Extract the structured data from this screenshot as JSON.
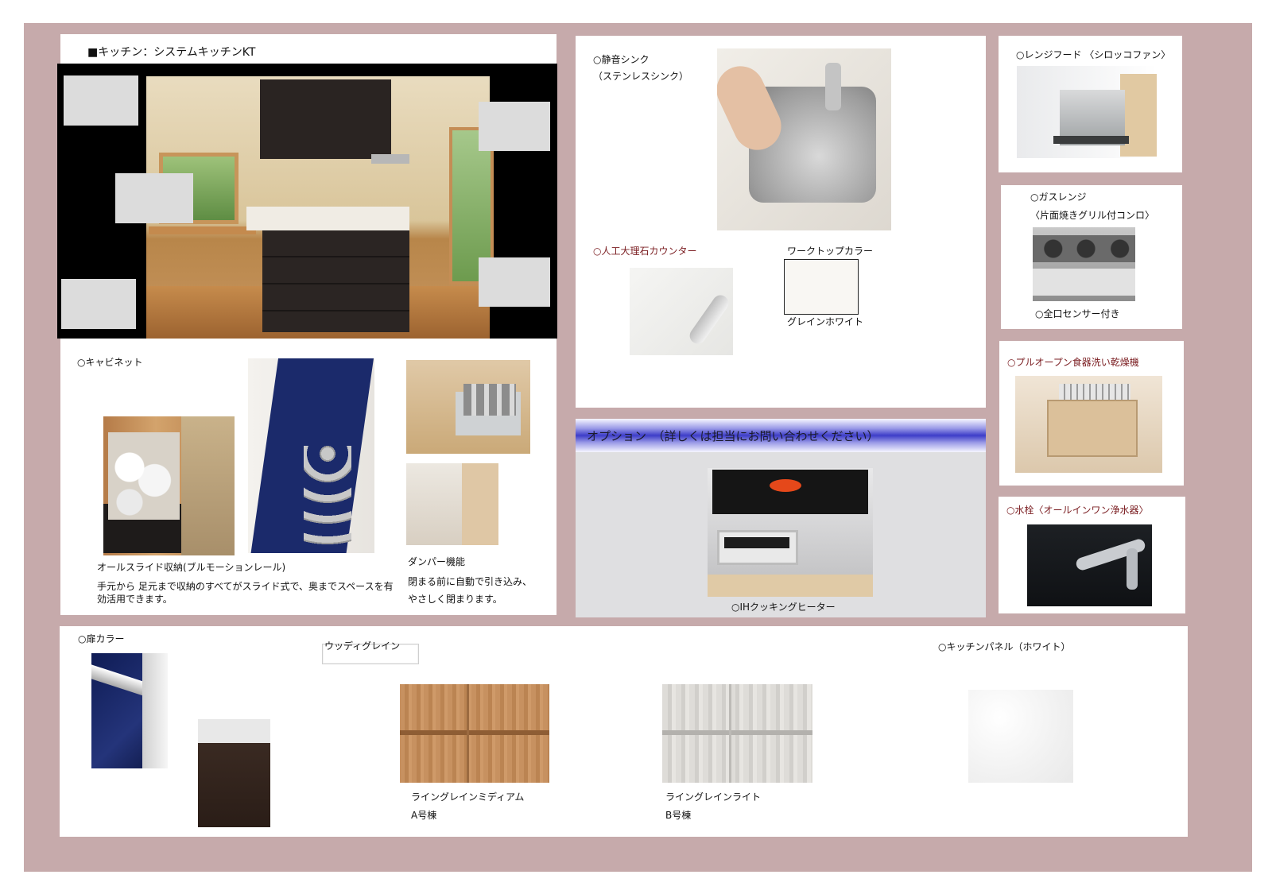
{
  "kitchen": {
    "title": "■キッチン：システムキッチンKT",
    "cabinet_label": "○キャビネット",
    "all_slide_title": "オールスライド収納(ブルモーションレール)",
    "all_slide_desc_1": "手元から 足元まで収納のすべてがスライド式で、奥までスペースを有",
    "all_slide_desc_2": "効活用できます。",
    "damper_title": "ダンパー機能",
    "damper_desc_1": "閉まる前に自動で引き込み、",
    "damper_desc_2": "やさしく閉まります。"
  },
  "sink": {
    "label_1": "○静音シンク",
    "label_2": "（ステンレスシンク）",
    "counter_label": "○人工大理石カウンター",
    "worktop_label": "ワークトップカラー",
    "worktop_color_name": "グレインホワイト"
  },
  "right": {
    "hood_label": "○レンジフード 〈シロッコファン〉",
    "gas_label_1": "○ガスレンジ",
    "gas_label_2": "〈片面焼きグリル付コンロ〉",
    "gas_sensor": "○全口センサー付き",
    "dish_label": "○プルオープン食器洗い乾燥機",
    "faucet_label": "○水栓〈オールインワン浄水器〉"
  },
  "option": {
    "title": "オプション　（詳しくは担当にお問い合わせください）",
    "ih_label": "○IHクッキングヒーター"
  },
  "bottom": {
    "door_color_label": "○扉カラー",
    "tag": "ウッディグレイン",
    "medium_name": "ライングレインミディアム",
    "medium_bldg": "A号棟",
    "light_name": "ライングレインライト",
    "light_bldg": "B号棟",
    "panel_label": "○キッチンパネル（ホワイト）"
  },
  "colors": {
    "frame": "#c6aaab",
    "accent_red": "#7a1c20",
    "option_blue": "#3d3dc8"
  }
}
